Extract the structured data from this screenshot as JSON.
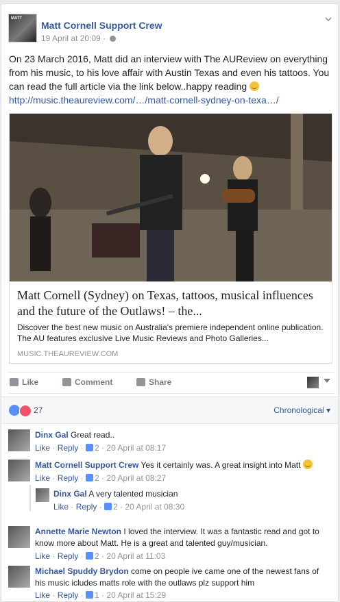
{
  "post": {
    "page_name": "Matt Cornell Support Crew",
    "timestamp": "19 April at 20:09",
    "text": "On 23 March 2016, Matt did an interview with The AUReview on everything from his music, to his love affair with Austin Texas and even his tattoos. You can read the full article via the link below..happy reading ",
    "link_text": "http://music.theaureview.com/…/matt-cornell-sydney-on-texa…/"
  },
  "link_preview": {
    "title": "Matt Cornell (Sydney) on Texas, tattoos, musical influences and the future of the Outlaws! – the...",
    "description": "Discover the best new music on Australia's premiere independent online publication. The AU features exclusive Live Music Reviews and Photo Galleries...",
    "domain": "MUSIC.THEAUREVIEW.COM"
  },
  "actions": {
    "like": "Like",
    "comment": "Comment",
    "share": "Share"
  },
  "reactions": {
    "count": "27",
    "order": "Chronological"
  },
  "comments": [
    {
      "author": "Dinx Gal",
      "text": "Great read..",
      "like": "Like",
      "reply": "Reply",
      "likes": "2",
      "time": "20 April at 08:17"
    },
    {
      "author": "Matt Cornell Support Crew",
      "text": "Yes it certainly was. A great insight into Matt",
      "like": "Like",
      "reply": "Reply",
      "likes": "2",
      "time": "20 April at 08:27"
    },
    {
      "author": "Dinx Gal",
      "text": "A very talented musician",
      "like": "Like",
      "reply": "Reply",
      "likes": "2",
      "time": "20 April at 08:30"
    },
    {
      "author": "Annette Marie Newton",
      "text": "I loved the interview. It was a fantastic read and got to know more about Matt. He is a great and talented guy/musician.",
      "like": "Like",
      "reply": "Reply",
      "likes": "2",
      "time": "20 April at 11:03"
    },
    {
      "author": "Michael Spuddy Brydon",
      "text": "come on people ive came one of the newest fans of his music icludes matts role with the outlaws plz support him",
      "like": "Like",
      "reply": "Reply",
      "likes": "1",
      "time": "20 April at 15:29"
    }
  ],
  "colors": {
    "link": "#365899",
    "meta": "#90949c",
    "text": "#1d2129"
  }
}
